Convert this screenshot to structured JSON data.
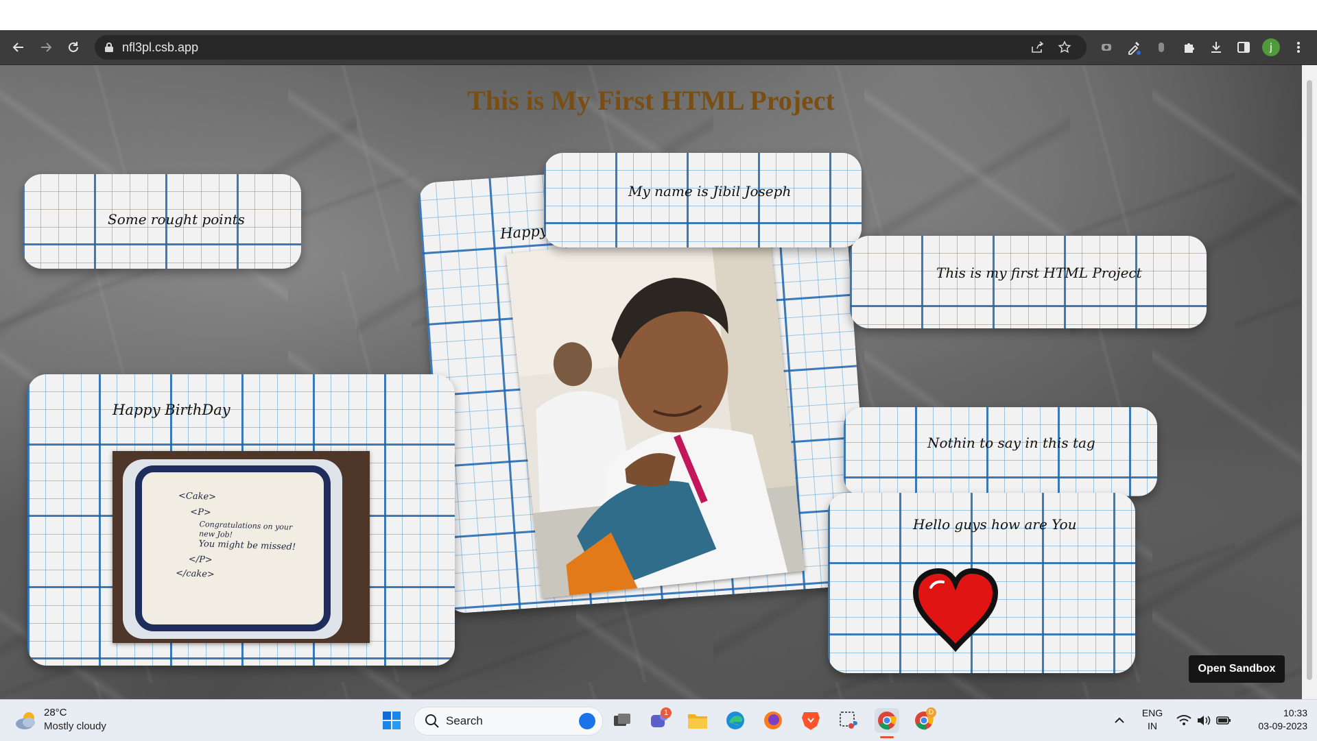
{
  "browser": {
    "url": "nfl3pl.csb.app",
    "avatar_letter": "j",
    "icons": [
      "back-arrow-icon",
      "forward-arrow-icon",
      "reload-icon",
      "lock-icon",
      "share-icon",
      "star-icon",
      "extension-icon",
      "eyedropper-icon",
      "extension-icon",
      "puzzle-icon",
      "download-icon",
      "side-panel-icon",
      "menu-dots-icon"
    ]
  },
  "page": {
    "title": "This is My First HTML Project",
    "cards": {
      "rough": "Some rought points",
      "name": "My name is Jibil Joseph",
      "happy": "Happy",
      "first_project": "This is my first HTML Project",
      "birthday": "Happy BirthDay",
      "nothing": "Nothin to say in this tag",
      "hello": "Hello guys how are You"
    },
    "cake_text": {
      "open_cake": "<Cake>",
      "open_p": "<P>",
      "line1": "Congratulations on your",
      "line2": "new Job!",
      "line3": "You might be missed!",
      "close_p": "</P>",
      "close_cake": "</cake>"
    },
    "open_sandbox": "Open Sandbox"
  },
  "taskbar": {
    "weather_temp": "28°C",
    "weather_desc": "Mostly cloudy",
    "search_label": "Search",
    "teams_badge": "1",
    "chrome_badge": "D",
    "lang_top": "ENG",
    "lang_bottom": "IN",
    "time": "10:33",
    "date": "03-09-2023"
  }
}
